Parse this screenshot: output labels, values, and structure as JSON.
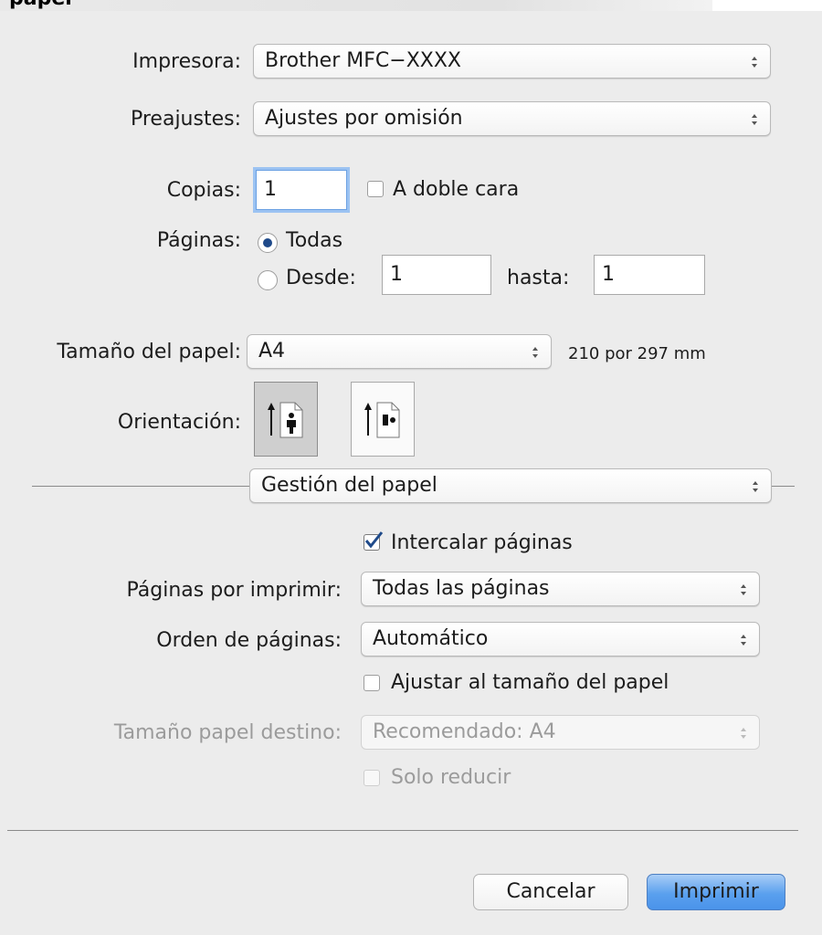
{
  "header": {
    "title": "papel"
  },
  "printer": {
    "label": "Impresora:",
    "value": "Brother MFC−XXXX"
  },
  "presets": {
    "label": "Preajustes:",
    "value": "Ajustes por omisión"
  },
  "copies": {
    "label": "Copias:",
    "value": "1",
    "duplex_label": "A doble cara",
    "duplex_checked": false
  },
  "pages": {
    "label": "Páginas:",
    "all_label": "Todas",
    "from_label": "Desde:",
    "from_value": "1",
    "to_label": "hasta:",
    "to_value": "1",
    "selected": "all"
  },
  "paper_size": {
    "label": "Tamaño del papel:",
    "value": "A4",
    "dimensions": "210 por 297 mm"
  },
  "orientation": {
    "label": "Orientación:",
    "selected": "portrait",
    "icons": [
      "portrait-orientation-icon",
      "landscape-orientation-icon"
    ]
  },
  "section": {
    "value": "Gestión del papel"
  },
  "collate": {
    "label": "Intercalar páginas",
    "checked": true
  },
  "pages_to_print": {
    "label": "Páginas por imprimir:",
    "value": "Todas las páginas"
  },
  "page_order": {
    "label": "Orden de páginas:",
    "value": "Automático"
  },
  "scale_to_fit": {
    "label": "Ajustar al tamaño del papel",
    "checked": false
  },
  "dest_paper_size": {
    "label": "Tamaño papel destino:",
    "value": "Recomendado: A4",
    "disabled": true
  },
  "scale_down_only": {
    "label": "Solo reducir",
    "checked": false,
    "disabled": true
  },
  "buttons": {
    "cancel": "Cancelar",
    "print": "Imprimir"
  },
  "colors": {
    "accent": "#5aa0ee",
    "focus_ring": "#9cc3f2",
    "radio_dot": "#1f4a8a",
    "check": "#1f4a8a"
  }
}
